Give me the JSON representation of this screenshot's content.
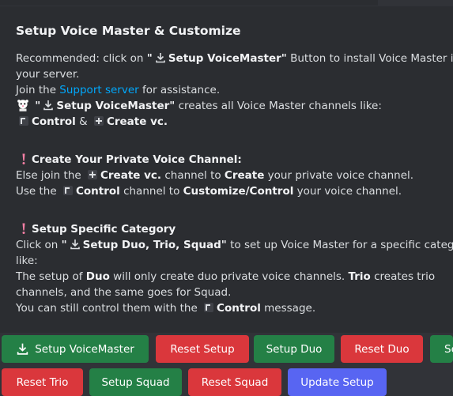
{
  "embed": {
    "title": "Setup Voice Master & Customize",
    "recommended_prefix": "Recommended: click on",
    "setup_vm_quoted": "Setup VoiceMaster",
    "recommended_suffix": "Button to install Voice Master in",
    "recommended_line2": "your server.",
    "join_prefix": "Join the",
    "support_link": "Support server",
    "join_suffix": "for assistance.",
    "creates_all_suffix": "creates all Voice Master channels like:",
    "control_label": "Control",
    "amp": "&",
    "create_vc_label": "Create vc.",
    "section1_title": "Create Your Private Voice Channel:",
    "s1_line1_prefix": "Else join the",
    "s1_line1_mid": "channel to",
    "s1_line1_create": "Create",
    "s1_line1_suffix": "your private voice channel.",
    "s1_line2_prefix": "Use the",
    "s1_line2_mid": "channel to",
    "s1_line2_customize": "Customize/Control",
    "s1_line2_suffix": "your voice channel.",
    "section2_title": "Setup Specific Category",
    "s2_click_prefix": "Click on",
    "s2_setup_duo_trio_squad": "Setup Duo, Trio, Squad",
    "s2_click_suffix": "to set up Voice Master for a specific category",
    "s2_like": "like:",
    "s2_setup_of": "The setup of",
    "s2_duo": "Duo",
    "s2_only_create": "will only create duo private voice channels.",
    "s2_trio": "Trio",
    "s2_creates_trio": "creates trio",
    "s2_line_channels": "channels, and the same goes for Squad.",
    "s2_still_prefix": "You can still control them with the",
    "s2_still_suffix": "message."
  },
  "buttons": {
    "setup_voicemaster": "Setup VoiceMaster",
    "reset_setup": "Reset Setup",
    "setup_duo": "Setup Duo",
    "reset_duo": "Reset Duo",
    "setup_trio_partial": "Se",
    "reset_trio": "Reset Trio",
    "setup_squad": "Setup Squad",
    "reset_squad": "Reset Squad",
    "update_setup": "Update Setup"
  },
  "colors": {
    "background": "#313338",
    "embed_bg": "#2b2d31",
    "green": "#248046",
    "red": "#da373c",
    "blurple": "#5865f2",
    "link": "#00a8fc"
  }
}
